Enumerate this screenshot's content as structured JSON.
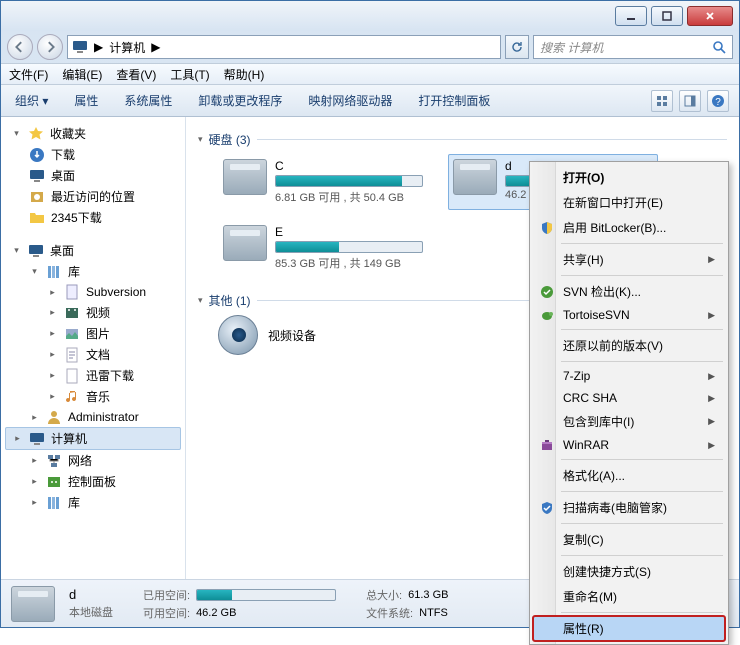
{
  "titlebar": {},
  "nav": {
    "path_label": "计算机",
    "path_sep": "▶",
    "search_placeholder": "搜索 计算机"
  },
  "menubar": {
    "file": "文件(F)",
    "edit": "编辑(E)",
    "view": "查看(V)",
    "tools": "工具(T)",
    "help": "帮助(H)"
  },
  "toolbar": {
    "organize": "组织 ▾",
    "properties": "属性",
    "sysprops": "系统属性",
    "uninstall": "卸载或更改程序",
    "mapdrive": "映射网络驱动器",
    "ctrlpanel": "打开控制面板"
  },
  "sidebar": {
    "favorites": "收藏夹",
    "downloads": "下载",
    "desktop": "桌面",
    "recent": "最近访问的位置",
    "dl2345": "2345下载",
    "desktop2": "桌面",
    "libraries": "库",
    "subversion": "Subversion",
    "videos": "视频",
    "pictures": "图片",
    "docs": "文档",
    "xunlei": "迅雷下载",
    "music": "音乐",
    "admin": "Administrator",
    "computer": "计算机",
    "network": "网络",
    "control": "控制面板",
    "libagain": "库"
  },
  "content": {
    "group_disks": "硬盘 (3)",
    "group_other": "其他 (1)",
    "drives": [
      {
        "letter": "C",
        "free_text": "6.81 GB 可用 , 共 50.4 GB",
        "fill_pct": 86,
        "selected": false
      },
      {
        "letter": "d",
        "free_text": "46.2",
        "fill_pct": 25,
        "selected": true
      },
      {
        "letter": "E",
        "free_text": "85.3 GB 可用 , 共 149 GB",
        "fill_pct": 43,
        "selected": false
      }
    ],
    "device_label": "视频设备"
  },
  "status": {
    "name": "d",
    "type": "本地磁盘",
    "used_label": "已用空间:",
    "free_label": "可用空间:",
    "free_value": "46.2 GB",
    "size_label": "总大小:",
    "size_value": "61.3 GB",
    "fs_label": "文件系统:",
    "fs_value": "NTFS",
    "used_pct": 25
  },
  "ctx": {
    "open": "打开(O)",
    "newwin": "在新窗口中打开(E)",
    "bitlocker": "启用 BitLocker(B)...",
    "share": "共享(H)",
    "svnco": "SVN 检出(K)...",
    "tortoise": "TortoiseSVN",
    "restore": "还原以前的版本(V)",
    "sevenzip": "7-Zip",
    "crcsha": "CRC SHA",
    "addlib": "包含到库中(I)",
    "winrar": "WinRAR",
    "format": "格式化(A)...",
    "scan": "扫描病毒(电脑管家)",
    "copy": "复制(C)",
    "shortcut": "创建快捷方式(S)",
    "rename": "重命名(M)",
    "props": "属性(R)"
  }
}
